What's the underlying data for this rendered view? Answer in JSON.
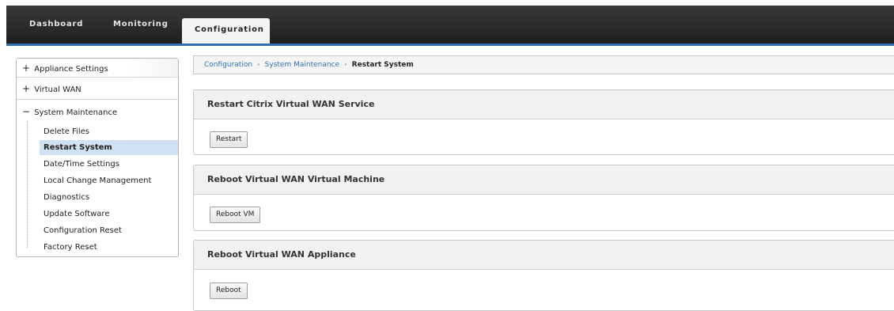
{
  "nav": {
    "tabs": [
      {
        "label": "Dashboard"
      },
      {
        "label": "Monitoring"
      },
      {
        "label": "Configuration"
      }
    ],
    "accent_color": "#2f6fb7"
  },
  "sidebar": {
    "groups": [
      {
        "symbol": "+",
        "label": "Appliance Settings"
      },
      {
        "symbol": "+",
        "label": "Virtual WAN"
      },
      {
        "symbol": "−",
        "label": "System Maintenance"
      }
    ],
    "items": [
      {
        "label": "Delete Files"
      },
      {
        "label": "Restart System"
      },
      {
        "label": "Date/Time Settings"
      },
      {
        "label": "Local Change Management"
      },
      {
        "label": "Diagnostics"
      },
      {
        "label": "Update Software"
      },
      {
        "label": "Configuration Reset"
      },
      {
        "label": "Factory Reset"
      }
    ],
    "active_item": "Restart System"
  },
  "breadcrumb": {
    "items": [
      "Configuration",
      "System Maintenance"
    ],
    "current": "Restart System",
    "separator": "›"
  },
  "panels": [
    {
      "title": "Restart Citrix Virtual WAN Service",
      "button": "Restart"
    },
    {
      "title": "Reboot Virtual WAN Virtual Machine",
      "button": "Reboot VM"
    },
    {
      "title": "Reboot Virtual WAN Appliance",
      "button": "Reboot"
    }
  ]
}
